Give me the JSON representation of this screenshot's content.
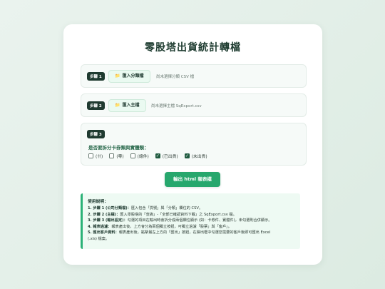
{
  "title": "零股塔出貨統計轉檔",
  "steps": [
    {
      "badge": "步驟 1",
      "button": "匯入分類檔",
      "note": "尚未選擇分類 CSV 檔"
    },
    {
      "badge": "步驟 2",
      "button": "匯入主檔",
      "note": "尚未選擇主檔 SqExport.csv"
    },
    {
      "badge": "步驟 3",
      "question": "是否要拆分卡券類與實體類：",
      "options": [
        {
          "label": "(卄)",
          "checked": false
        },
        {
          "label": "(零)",
          "checked": false
        },
        {
          "label": "(總件)",
          "checked": false
        },
        {
          "label": "(已出貨)",
          "checked": true
        },
        {
          "label": "(未出貨)",
          "checked": true
        }
      ]
    }
  ],
  "export_label": "輸出 html 報表檔",
  "help": {
    "title": "使用說明：",
    "lines": [
      {
        "head": "1. 步驟 1 (公司分類檔)：",
        "text": "匯入包含「貨號」與「分類」欄位的 CSV。"
      },
      {
        "head": "2. 步驟 2 (主檔)：",
        "text": "匯入零股塔的「查詢」-「全部已確認資料下載」之 SqExport.csv 檔。"
      },
      {
        "head": "3. 步驟 3 (輸出設定)：",
        "text": "勾選的項目在輸出時會拆分成兩個欄位顯示 (如：卡券件、實體件)，未勾選則合併顯示。"
      },
      {
        "head": "4. 報表過濾：",
        "text": "報表產出後，上方會分為兩個獨立按鈕，可獨立過濾「股票」與「客戶」。"
      },
      {
        "head": "5. 匯出客戶資料：",
        "text": "報表產出後，點擊最左上方的「匯出」按鈕，在彈出框中勾選您需要的客戶後即可匯出 Excel"
      },
      {
        "head": "",
        "text": "(.xls) 檔案。"
      }
    ]
  },
  "icons": {
    "folder": "folder-icon",
    "check": "check-icon"
  },
  "colors": {
    "accent": "#27a76d",
    "badge": "#1f3a30",
    "help_border": "#2bb277"
  }
}
